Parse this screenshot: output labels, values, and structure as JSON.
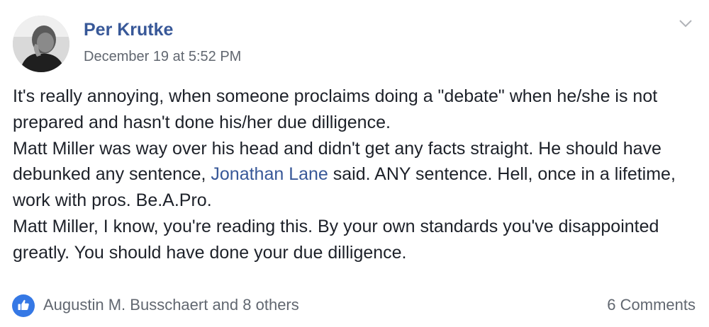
{
  "post": {
    "author_name": "Per Krutke",
    "timestamp": "December 19 at 5:52 PM",
    "menu_icon": "chevron-down-icon",
    "paragraphs": [
      {
        "before": "It's really annoying, when someone proclaims doing a \"debate\" when he/she is not prepared and hasn't done his/her due dilligence.",
        "mention": "",
        "after": ""
      },
      {
        "before": "Matt Miller was way over his head and didn't get any facts straight. He should have debunked any sentence, ",
        "mention": "Jonathan Lane",
        "after": " said. ANY sentence. Hell, once in a lifetime, work with pros. Be.A.Pro."
      },
      {
        "before": "Matt Miller, I know, you're reading this. By your own standards you've disappointed greatly. You should have done your due dilligence.",
        "mention": "",
        "after": ""
      }
    ]
  },
  "footer": {
    "reaction_icon": "like-icon",
    "reactors_text": "Augustin M. Busschaert and 8 others",
    "comments_text": "6 Comments"
  },
  "colors": {
    "link": "#385898",
    "meta": "#616770",
    "text": "#1d2129",
    "like_blue": "#3578e5"
  }
}
